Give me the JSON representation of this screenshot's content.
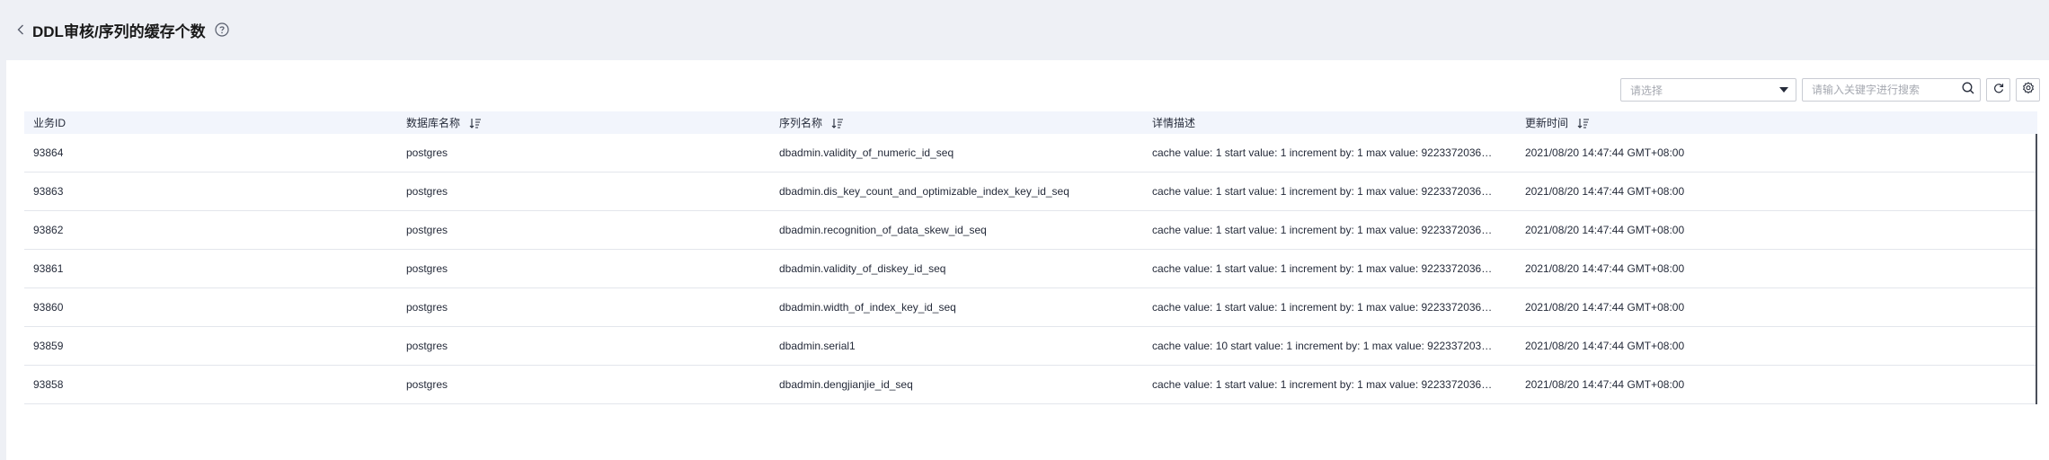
{
  "header": {
    "title": "DDL审核/序列的缓存个数",
    "back_icon": "chevron-left-icon",
    "help_icon": "question-circle-icon"
  },
  "toolbar": {
    "select": {
      "placeholder": "请选择"
    },
    "search": {
      "placeholder": "请输入关键字进行搜索",
      "value": ""
    },
    "refresh_icon": "refresh-icon",
    "settings_icon": "gear-icon"
  },
  "table": {
    "columns": [
      {
        "label": "业务ID",
        "sortable": false
      },
      {
        "label": "数据库名称",
        "sortable": true
      },
      {
        "label": "序列名称",
        "sortable": true
      },
      {
        "label": "详情描述",
        "sortable": false
      },
      {
        "label": "更新时间",
        "sortable": true
      }
    ],
    "rows": [
      {
        "id": "93864",
        "db": "postgres",
        "seq": "dbadmin.validity_of_numeric_id_seq",
        "desc": "cache value: 1 start value: 1 increment by: 1 max value: 92233720368...",
        "time": "2021/08/20 14:47:44 GMT+08:00"
      },
      {
        "id": "93863",
        "db": "postgres",
        "seq": "dbadmin.dis_key_count_and_optimizable_index_key_id_seq",
        "desc": "cache value: 1 start value: 1 increment by: 1 max value: 92233720368...",
        "time": "2021/08/20 14:47:44 GMT+08:00"
      },
      {
        "id": "93862",
        "db": "postgres",
        "seq": "dbadmin.recognition_of_data_skew_id_seq",
        "desc": "cache value: 1 start value: 1 increment by: 1 max value: 92233720368...",
        "time": "2021/08/20 14:47:44 GMT+08:00"
      },
      {
        "id": "93861",
        "db": "postgres",
        "seq": "dbadmin.validity_of_diskey_id_seq",
        "desc": "cache value: 1 start value: 1 increment by: 1 max value: 92233720368...",
        "time": "2021/08/20 14:47:44 GMT+08:00"
      },
      {
        "id": "93860",
        "db": "postgres",
        "seq": "dbadmin.width_of_index_key_id_seq",
        "desc": "cache value: 1 start value: 1 increment by: 1 max value: 92233720368...",
        "time": "2021/08/20 14:47:44 GMT+08:00"
      },
      {
        "id": "93859",
        "db": "postgres",
        "seq": "dbadmin.serial1",
        "desc": "cache value: 10 start value: 1 increment by: 1 max value: 9223372036...",
        "time": "2021/08/20 14:47:44 GMT+08:00"
      },
      {
        "id": "93858",
        "db": "postgres",
        "seq": "dbadmin.dengjianjie_id_seq",
        "desc": "cache value: 1 start value: 1 increment by: 1 max value: 92233720368...",
        "time": "2021/08/20 14:47:44 GMT+08:00"
      }
    ]
  }
}
